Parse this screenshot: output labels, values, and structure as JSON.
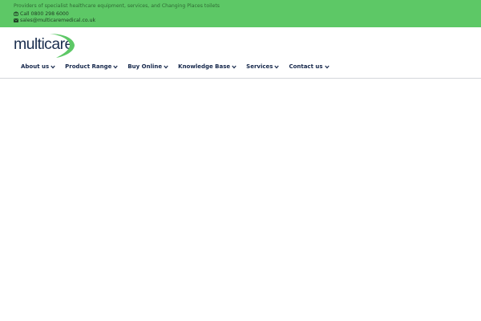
{
  "topbar": {
    "tagline": "Providers of specialist healthcare equipment, services, and Changing Places toilets",
    "phone": {
      "icon": "phone-icon",
      "text": "Call 0800 298 6000"
    },
    "email": {
      "icon": "envelope-icon",
      "text": "sales@multicaremedical.co.uk"
    },
    "background_color": "#5dc866"
  },
  "logo": {
    "text": "multicare",
    "swoosh_color": "#5dc866",
    "text_color": "#1c2f4f"
  },
  "nav": {
    "items": [
      {
        "label": "About us",
        "icon": "chevron-down-icon"
      },
      {
        "label": "Product Range",
        "icon": "chevron-down-icon"
      },
      {
        "label": "Buy Online",
        "icon": "chevron-down-icon"
      },
      {
        "label": "Knowledge Base",
        "icon": "chevron-down-icon"
      },
      {
        "label": "Services",
        "icon": "chevron-down-icon"
      },
      {
        "label": "Contact us",
        "icon": "chevron-down-icon"
      }
    ]
  }
}
